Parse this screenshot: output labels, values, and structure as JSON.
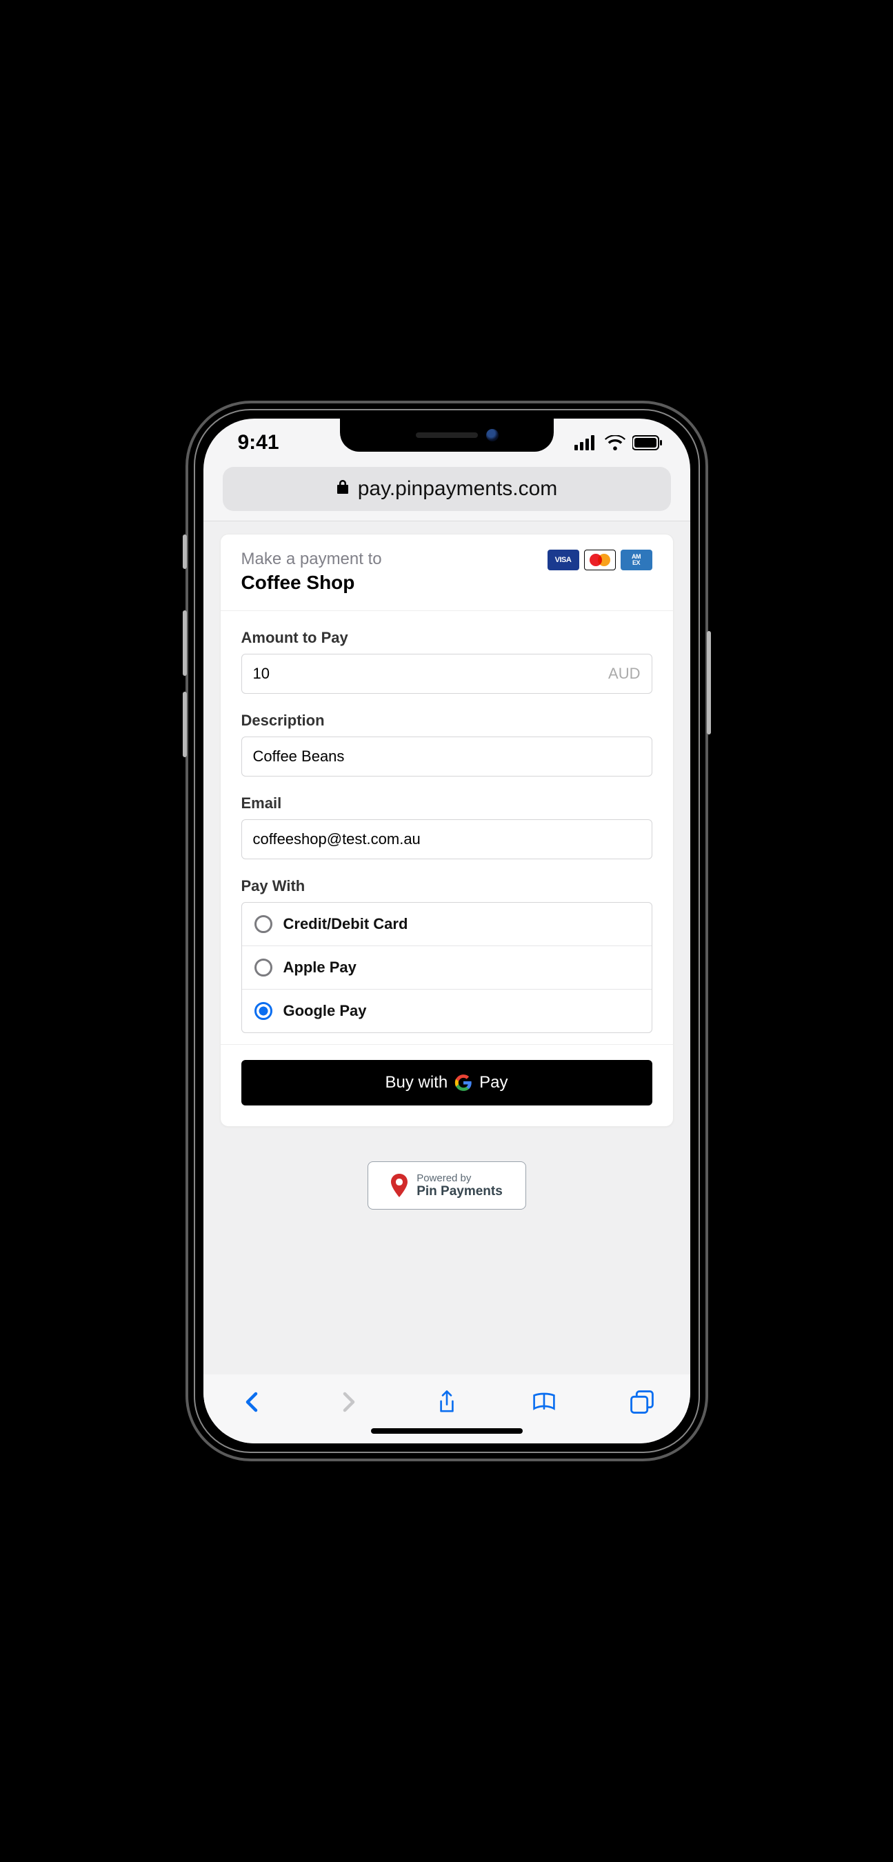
{
  "status": {
    "time": "9:41"
  },
  "browser": {
    "url": "pay.pinpayments.com"
  },
  "header": {
    "prompt": "Make a payment to",
    "merchant": "Coffee Shop",
    "card_brands": [
      "VISA",
      "mastercard",
      "AMEX"
    ]
  },
  "form": {
    "amount_label": "Amount to Pay",
    "amount_value": "10",
    "amount_currency": "AUD",
    "description_label": "Description",
    "description_value": "Coffee Beans",
    "email_label": "Email",
    "email_value": "coffeeshop@test.com.au",
    "paywith_label": "Pay With",
    "paywith_options": {
      "card": "Credit/Debit Card",
      "apple": "Apple Pay",
      "google": "Google Pay"
    },
    "paywith_selected": "google"
  },
  "cta": {
    "prefix": "Buy with",
    "suffix": "Pay"
  },
  "powered": {
    "line1": "Powered by",
    "line2": "Pin Payments"
  }
}
